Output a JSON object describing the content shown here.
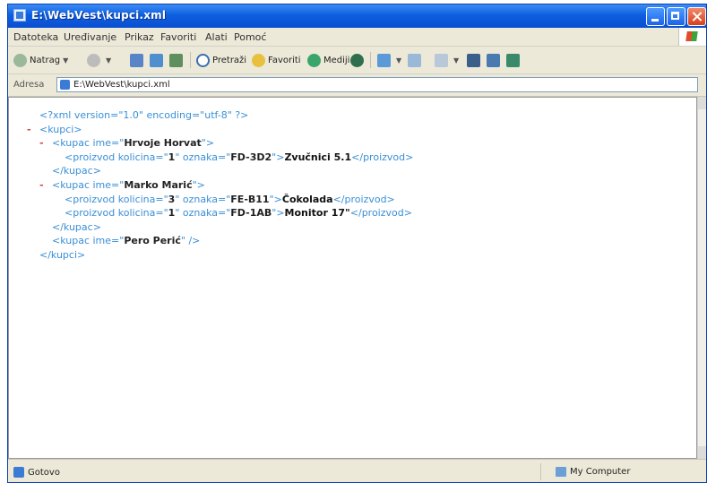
{
  "window": {
    "title": "E:\\WebVest\\kupci.xml"
  },
  "menu": {
    "items": [
      "Datoteka",
      "Uređivanje",
      "Prikaz",
      "Favoriti",
      "Alati",
      "Pomoć"
    ]
  },
  "toolbar": {
    "back_label": "Natrag",
    "search_label": "Pretraži",
    "favorites_label": "Favoriti",
    "media_label": "Mediji"
  },
  "address": {
    "label": "Adresa",
    "value": "E:\\WebVest\\kupci.xml"
  },
  "xml_doc": {
    "declaration": "<?xml version=\"1.0\" encoding=\"utf-8\" ?>",
    "root_open": "<kupci>",
    "root_close": "</kupci>",
    "kupac1": {
      "open_prefix": "<kupac ime=\"",
      "ime": "Hrvoje Horvat",
      "open_suffix": "\">",
      "p1": {
        "prefix": "<proizvod kolicina=\"",
        "kolicina": "1",
        "mid": "\" oznaka=\"",
        "oznaka": "FD-3D2",
        "suffix": "\">",
        "text": "Zvučnici 5.1",
        "close": "</proizvod>"
      },
      "close": "</kupac>"
    },
    "kupac2": {
      "open_prefix": "<kupac ime=\"",
      "ime": "Marko Marić",
      "open_suffix": "\">",
      "p1": {
        "prefix": "<proizvod kolicina=\"",
        "kolicina": "3",
        "mid": "\" oznaka=\"",
        "oznaka": "FE-B11",
        "suffix": "\">",
        "text": "Čokolada",
        "close": "</proizvod>"
      },
      "p2": {
        "prefix": "<proizvod kolicina=\"",
        "kolicina": "1",
        "mid": "\" oznaka=\"",
        "oznaka": "FD-1AB",
        "suffix": "\">",
        "text": "Monitor 17\"",
        "close": "</proizvod>"
      },
      "close": "</kupac>"
    },
    "kupac3": {
      "open_prefix": "<kupac ime=\"",
      "ime": "Pero Perić",
      "open_suffix": "\" />"
    },
    "collapse_marker": "-"
  },
  "status": {
    "text": "Gotovo",
    "zone": "My Computer"
  },
  "colors": {
    "titlebar": "#0d5fe0",
    "xml_tag": "#3a8fd6",
    "collapse_minus": "#d04545"
  }
}
